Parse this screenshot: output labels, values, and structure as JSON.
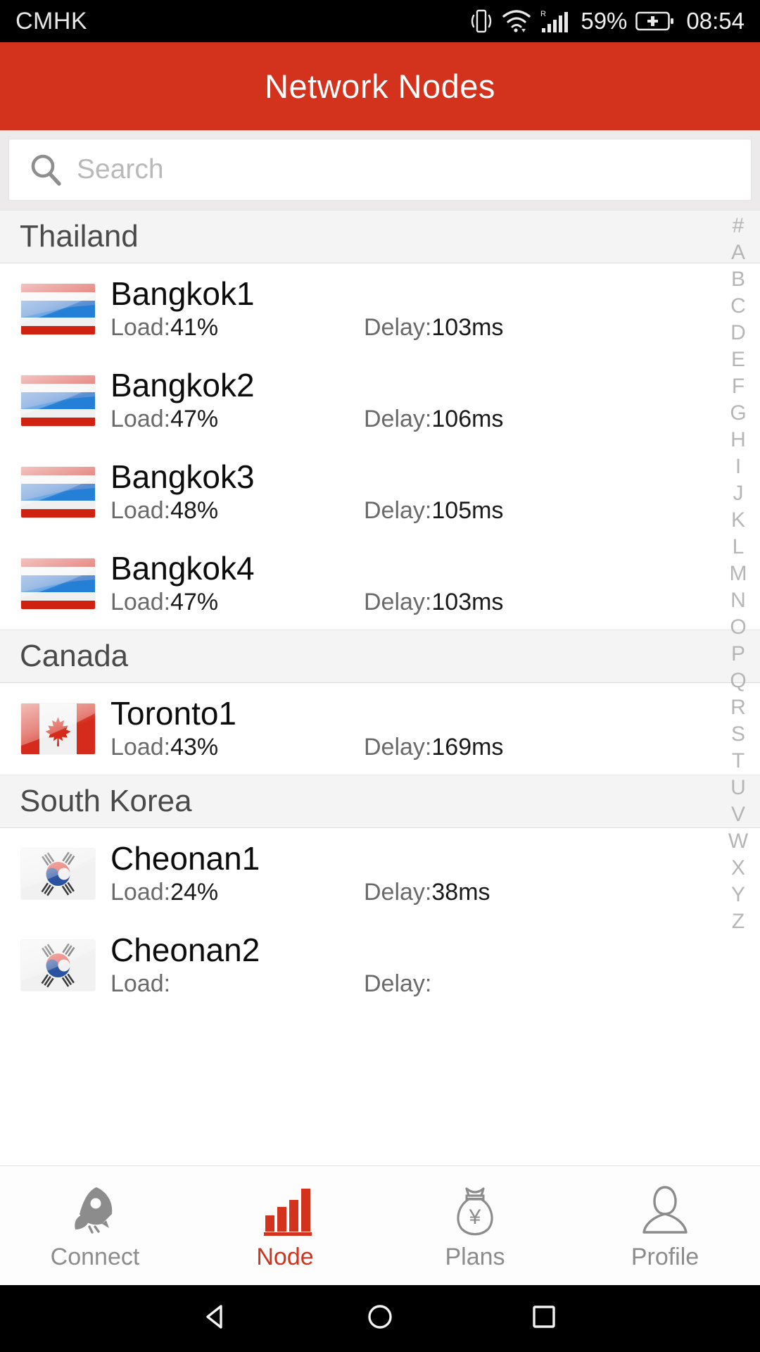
{
  "status_bar": {
    "carrier": "CMHK",
    "battery_percent": "59%",
    "time": "08:54",
    "icons": [
      "vibrate-icon",
      "wifi-icon",
      "cellular-signal-icon",
      "battery-charging-icon"
    ],
    "roaming_mark": "R"
  },
  "app_bar": {
    "title": "Network Nodes"
  },
  "search": {
    "value": "",
    "placeholder": "Search",
    "icon": "search-icon"
  },
  "alpha_index": [
    "#",
    "A",
    "B",
    "C",
    "D",
    "E",
    "F",
    "G",
    "H",
    "I",
    "J",
    "K",
    "L",
    "M",
    "N",
    "O",
    "P",
    "Q",
    "R",
    "S",
    "T",
    "U",
    "V",
    "W",
    "X",
    "Y",
    "Z"
  ],
  "sections": [
    {
      "country": "Thailand",
      "flag": "flag-thailand",
      "nodes": [
        {
          "name": "Bangkok1",
          "load_label": "Load:",
          "load_value": "41%",
          "delay_label": "Delay:",
          "delay_value": "103ms"
        },
        {
          "name": "Bangkok2",
          "load_label": "Load:",
          "load_value": "47%",
          "delay_label": "Delay:",
          "delay_value": "106ms"
        },
        {
          "name": "Bangkok3",
          "load_label": "Load:",
          "load_value": "48%",
          "delay_label": "Delay:",
          "delay_value": "105ms"
        },
        {
          "name": "Bangkok4",
          "load_label": "Load:",
          "load_value": "47%",
          "delay_label": "Delay:",
          "delay_value": "103ms"
        }
      ]
    },
    {
      "country": "Canada",
      "flag": "flag-canada",
      "nodes": [
        {
          "name": "Toronto1",
          "load_label": "Load:",
          "load_value": "43%",
          "delay_label": "Delay:",
          "delay_value": "169ms"
        }
      ]
    },
    {
      "country": "South Korea",
      "flag": "flag-south-korea",
      "nodes": [
        {
          "name": "Cheonan1",
          "load_label": "Load:",
          "load_value": "24%",
          "delay_label": "Delay:",
          "delay_value": "38ms"
        },
        {
          "name": "Cheonan2",
          "load_label": "Load:",
          "load_value": "",
          "delay_label": "Delay:",
          "delay_value": ""
        }
      ]
    }
  ],
  "tab_bar": {
    "active": "Node",
    "active_color": "#d3321d",
    "inactive_color": "#8c8c8c",
    "items": [
      {
        "label": "Connect",
        "icon": "rocket-icon"
      },
      {
        "label": "Node",
        "icon": "bar-chart-icon"
      },
      {
        "label": "Plans",
        "icon": "money-bag-icon"
      },
      {
        "label": "Profile",
        "icon": "person-icon"
      }
    ]
  },
  "nav_bar": {
    "items": [
      "back-triangle-icon",
      "home-circle-icon",
      "recents-square-icon"
    ]
  },
  "colors": {
    "brand_red": "#d3321d",
    "section_bg": "#f4f4f4",
    "status_bg": "#000000"
  }
}
